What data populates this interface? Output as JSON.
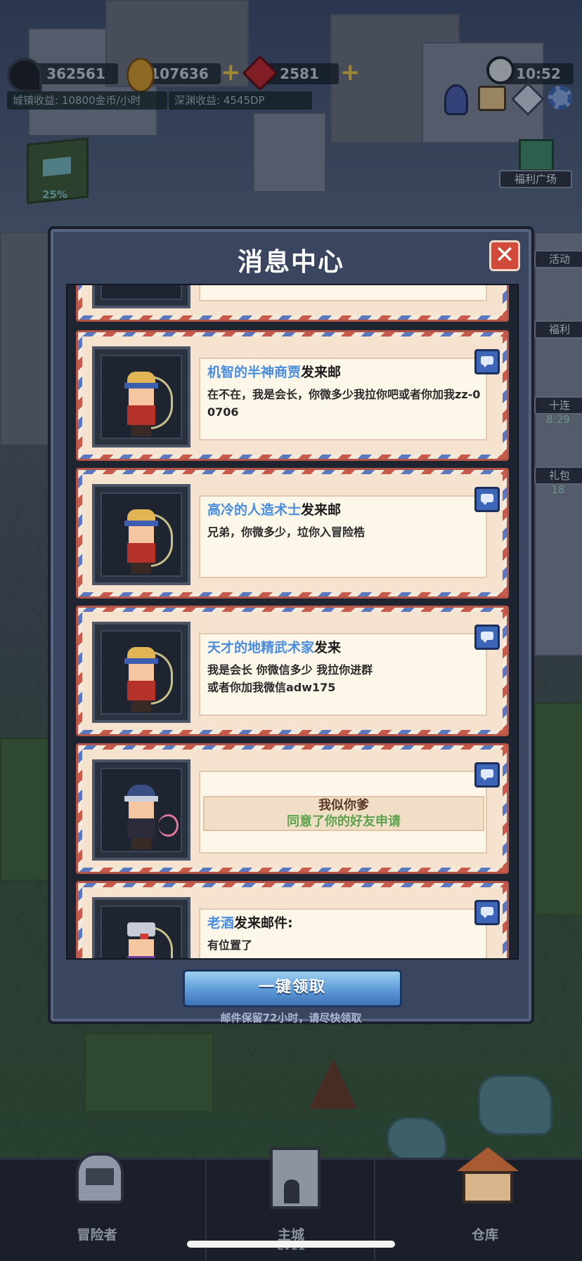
{
  "hud": {
    "pickaxe_value": "362561",
    "gold_value": "107636",
    "gem_value": "2581",
    "clock_time": "10:52",
    "town_income": "城镇收益: 10800金币/小时",
    "abyss_income": "深渊收益: 4545DP",
    "progress_percent": "25%"
  },
  "side_buttons": {
    "welfare_plaza": "福利广场",
    "activity": "活动",
    "welfare": "福利",
    "ten_pull": "十连",
    "ten_pull_timer": "8:29",
    "gift_pack": "礼包",
    "gift_timer": "18"
  },
  "modal": {
    "title": "消息中心",
    "close_label": "✕",
    "claim_all_label": "一键领取",
    "retention_note": "邮件保留72小时，请尽快领取"
  },
  "mails": [
    {
      "sender_name": "机智的半神商贾",
      "sender_suffix": "发来邮",
      "body": "在不在，我是会长，你微多少我拉你吧或者你加我zz-0\n0706"
    },
    {
      "sender_name": "高冷的人造术士",
      "sender_suffix": "发来邮",
      "body": "兄弟，你微多少，垃你入冒险梏"
    },
    {
      "sender_name": "天才的地精武术家",
      "sender_suffix": "发来",
      "body": "我是会长 你微信多少 我拉你进群\n或者你加我微信adw175"
    },
    {
      "friend_name": "我似你爹",
      "friend_status": "同意了你的好友申请"
    },
    {
      "sender_name": "老酒",
      "sender_suffix": "发来邮件:",
      "body": "有位置了"
    }
  ],
  "nav": {
    "adventurer": "冒险者",
    "main_city": "主城",
    "main_city_level": "Lv11",
    "warehouse": "仓库"
  },
  "colors": {
    "sender_name": "#4a8ddc",
    "friend_status": "#5da34d",
    "close_button": "#d24a3c",
    "claim_button": "#5d9ad7"
  },
  "icons": [
    "pickaxe-icon",
    "gold-coin-icon",
    "red-gem-icon",
    "clock-icon",
    "speech-bubble-icon",
    "gear-icon",
    "compass-icon"
  ]
}
